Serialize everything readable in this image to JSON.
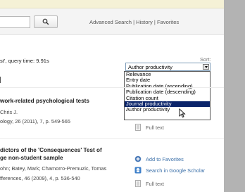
{
  "search": {
    "value": "",
    "button_label": "Q"
  },
  "header_links": [
    "Advanced Search",
    "History",
    "Favorites"
  ],
  "query_info": "st', query time: 9.91s",
  "sort": {
    "label": "Sort:",
    "selected": "Author productivity",
    "options": [
      "Relevance",
      "Entry date",
      "Publication date (ascending)",
      "Publication date (descending)",
      "Citation count",
      "Journal productivity",
      "Author productivity"
    ],
    "highlighted": "Journal productivity"
  },
  "results": [
    {
      "title": "work-related psychological tests",
      "authors": "Chris J.",
      "source": "ology, 26 (2011), 7, p. 549-565"
    },
    {
      "title_line1": "dictors of the 'Consequences' Test of",
      "title_line2": "ge non-student sample",
      "authors": "ohn; Batey, Mark; Chamorro-Premuzic, Tomas",
      "source": "fferences, 46 (2009), 4, p. 536-540"
    }
  ],
  "actions": {
    "full_text": "Full text",
    "add_favorites": "Add to Favorites",
    "google_scholar": "Search in Google Scholar"
  }
}
